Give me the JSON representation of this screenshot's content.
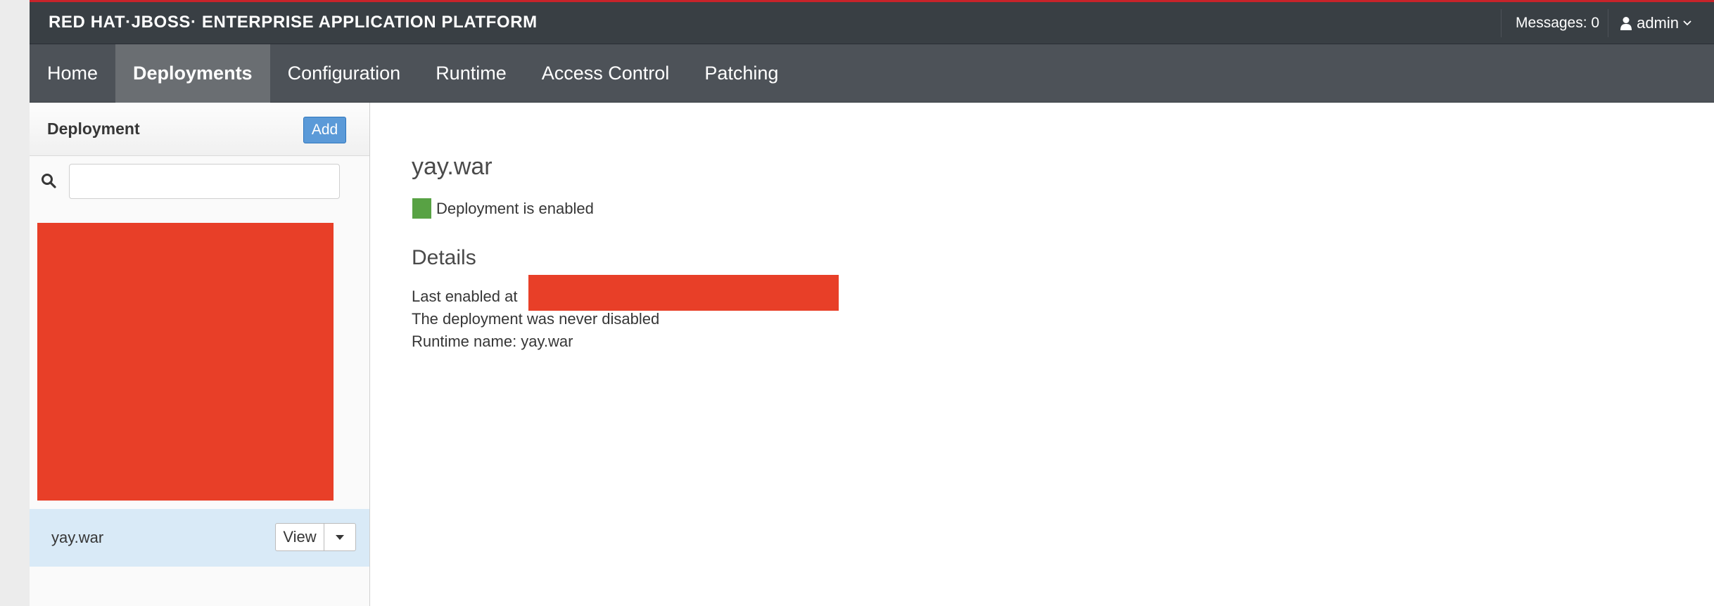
{
  "brand": {
    "title": "RED HAT·JBOSS· ENTERPRISE APPLICATION PLATFORM"
  },
  "header": {
    "messages": "Messages: 0",
    "user": "admin",
    "user_icon": "user-icon",
    "caret_icon": "chevron-down-icon"
  },
  "nav": {
    "items": [
      {
        "label": "Home",
        "active": false
      },
      {
        "label": "Deployments",
        "active": true
      },
      {
        "label": "Configuration",
        "active": false
      },
      {
        "label": "Runtime",
        "active": false
      },
      {
        "label": "Access Control",
        "active": false
      },
      {
        "label": "Patching",
        "active": false
      }
    ]
  },
  "sidebar": {
    "title": "Deployment",
    "add_label": "Add",
    "search_placeholder": "",
    "search_value": "",
    "items": [
      {
        "name": "yay.war",
        "view_label": "View"
      }
    ]
  },
  "main": {
    "title": "yay.war",
    "status": "Deployment is enabled",
    "status_color": "#58a244",
    "details_heading": "Details",
    "last_enabled_label": "Last enabled at",
    "never_disabled": "The deployment was never disabled",
    "runtime_name": "Runtime name: yay.war"
  },
  "colors": {
    "accent": "#5b9ad8",
    "masthead": "#393f44",
    "navbar": "#4d5258",
    "selected_row": "#d9eaf7",
    "redaction": "#e83f28"
  }
}
